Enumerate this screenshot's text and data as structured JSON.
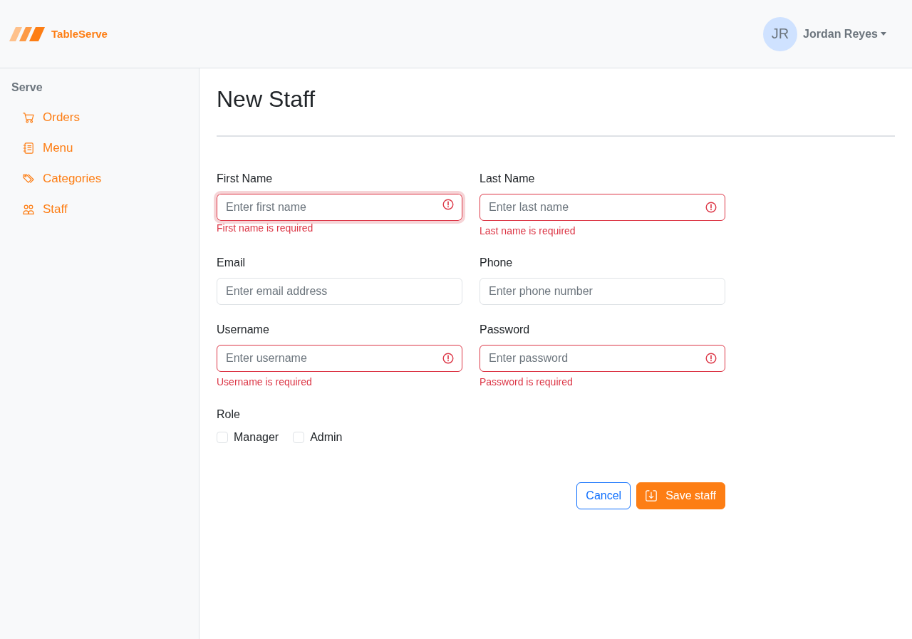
{
  "brand": {
    "name": "TableServe"
  },
  "user": {
    "initials": "JR",
    "name": "Jordan Reyes"
  },
  "sidebar": {
    "section": "Serve",
    "items": [
      {
        "label": "Orders"
      },
      {
        "label": "Menu"
      },
      {
        "label": "Categories"
      },
      {
        "label": "Staff"
      }
    ]
  },
  "page": {
    "title": "New Staff"
  },
  "form": {
    "fields": [
      {
        "label": "First Name",
        "placeholder": "Enter first name",
        "invalid": true,
        "focused": true,
        "error": "First name is required"
      },
      {
        "label": "Last Name",
        "placeholder": "Enter last name",
        "invalid": true,
        "focused": false,
        "error": "Last name is required"
      },
      {
        "label": "Email",
        "placeholder": "Enter email address",
        "invalid": false,
        "focused": false
      },
      {
        "label": "Phone",
        "placeholder": "Enter phone number",
        "invalid": false,
        "focused": false
      },
      {
        "label": "Username",
        "placeholder": "Enter username",
        "invalid": true,
        "focused": false,
        "error": "Username is required"
      },
      {
        "label": "Password",
        "placeholder": "Enter password",
        "invalid": true,
        "focused": false,
        "error": "Password is required"
      }
    ],
    "role": {
      "label": "Role",
      "options": [
        {
          "label": "Manager",
          "checked": false
        },
        {
          "label": "Admin",
          "checked": false
        }
      ]
    },
    "buttons": [
      {
        "label": "Cancel",
        "kind": "outline"
      },
      {
        "label": "Save staff",
        "kind": "primary"
      }
    ]
  }
}
